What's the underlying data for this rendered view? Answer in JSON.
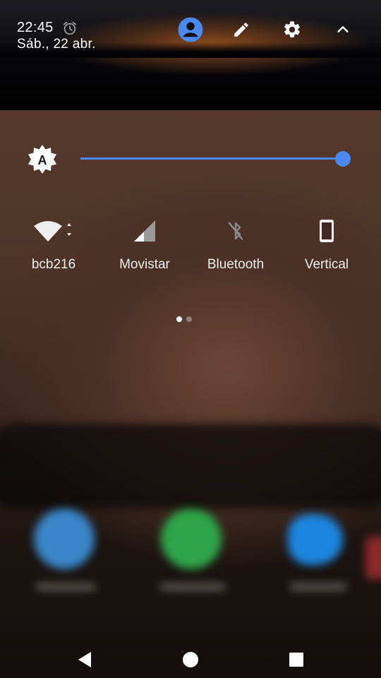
{
  "status": {
    "time": "22:45",
    "date": "Sáb., 22 abr."
  },
  "brightness": {
    "level_percent": 100,
    "track_color": "#4a8af0"
  },
  "tiles": [
    {
      "label": "bcb216",
      "icon": "wifi-icon"
    },
    {
      "label": "Movistar",
      "icon": "cellular-signal-icon"
    },
    {
      "label": "Bluetooth",
      "icon": "bluetooth-off-icon"
    },
    {
      "label": "Vertical",
      "icon": "rotation-portrait-icon"
    }
  ],
  "page_indicator": {
    "current": 1,
    "total": 2
  },
  "colors": {
    "accent": "#4a8af0",
    "user_icon": "#4a8af0",
    "text": "#ffffff"
  },
  "nav": {
    "back": "back-icon",
    "home": "home-icon",
    "recents": "recents-icon"
  }
}
